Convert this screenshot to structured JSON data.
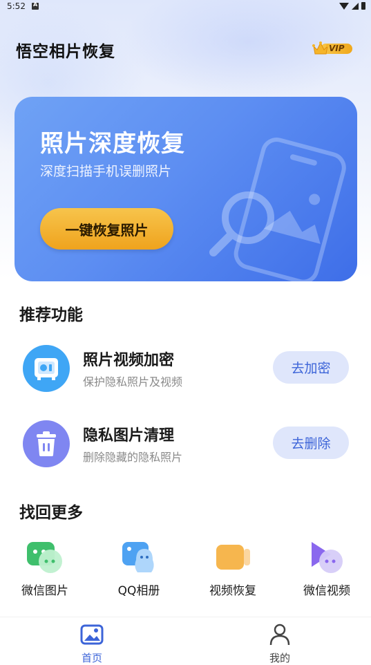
{
  "status_bar": {
    "time": "5:52"
  },
  "header": {
    "title": "悟空相片恢复",
    "vip_label": "VIP"
  },
  "banner": {
    "title": "照片深度恢复",
    "subtitle": "深度扫描手机误删照片",
    "button_label": "一键恢复照片"
  },
  "recommend": {
    "section_title": "推荐功能",
    "items": [
      {
        "title": "照片视频加密",
        "desc": "保护隐私照片及视频",
        "button": "去加密",
        "icon": "safe-icon",
        "color": "#3fa6f5"
      },
      {
        "title": "隐私图片清理",
        "desc": "删除隐藏的隐私照片",
        "button": "去删除",
        "icon": "trash-icon",
        "color": "#7f86f1"
      }
    ]
  },
  "more": {
    "section_title": "找回更多",
    "items": [
      {
        "label": "微信图片",
        "icon": "wechat-icon"
      },
      {
        "label": "QQ相册",
        "icon": "qq-icon"
      },
      {
        "label": "视频恢复",
        "icon": "video-icon"
      },
      {
        "label": "微信视频",
        "icon": "wechat-video-icon"
      }
    ]
  },
  "bottom_nav": {
    "items": [
      {
        "label": "首页",
        "icon": "home-photo-icon",
        "active": true
      },
      {
        "label": "我的",
        "icon": "person-icon",
        "active": false
      }
    ]
  },
  "colors": {
    "accent": "#3c64d8",
    "banner_start": "#6fa2f5",
    "banner_end": "#3e6ee8",
    "button_gold": "#f0a81c",
    "pill_bg": "#dfe6fb"
  }
}
